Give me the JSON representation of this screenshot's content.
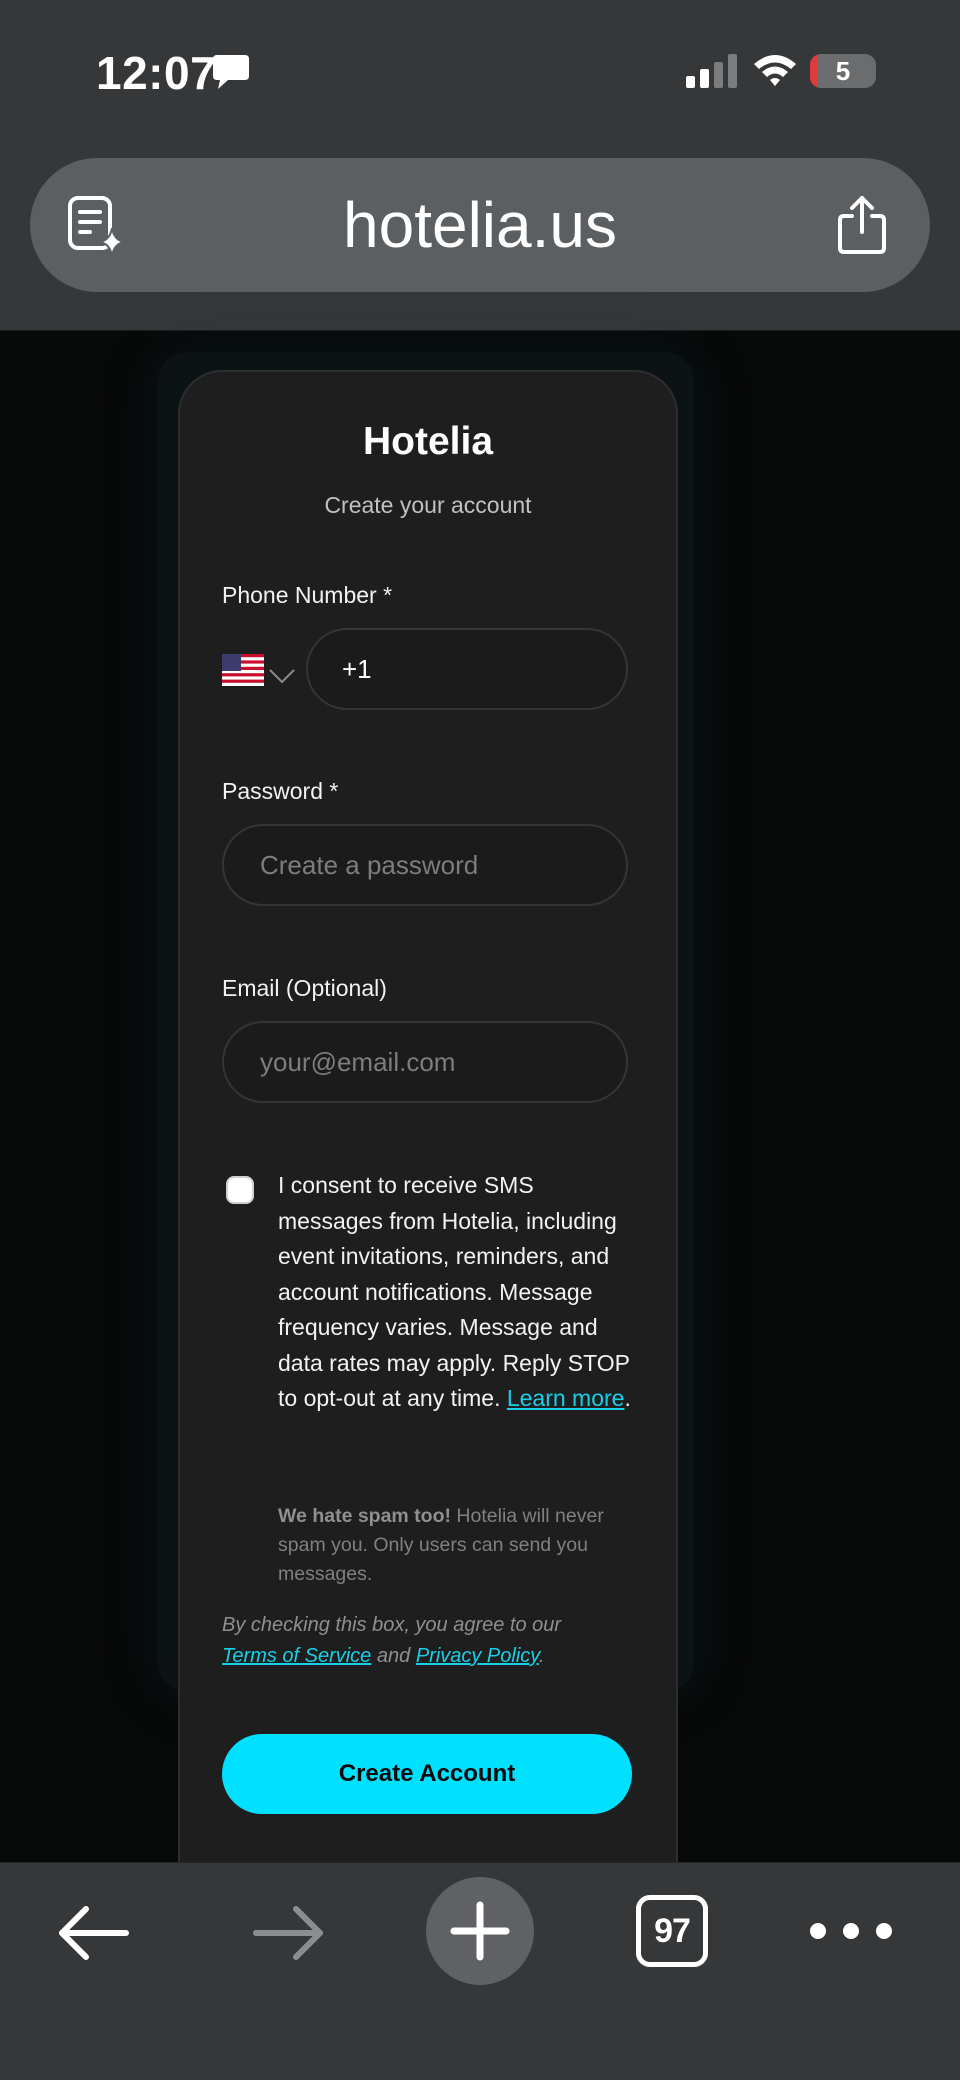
{
  "status_bar": {
    "time": "12:07",
    "battery": "5",
    "icons": [
      "message-icon",
      "signal-icon",
      "wifi-icon",
      "battery-icon"
    ]
  },
  "browser": {
    "url": "hotelia.us",
    "icons": [
      "reader-summary-icon",
      "share-icon"
    ]
  },
  "form": {
    "brand": "Hotelia",
    "subtitle": "Create your account",
    "phone_label": "Phone Number *",
    "phone_value": "+1",
    "country_flag": "us-flag-icon",
    "password_label": "Password *",
    "password_placeholder": "Create a password",
    "email_label": "Email (Optional)",
    "email_placeholder": "your@email.com",
    "consent_text": "I consent to receive SMS messages from Hotelia, including event invitations, reminders, and account notifications. Message frequency varies. Message and data rates may apply. Reply STOP to opt-out at any time.",
    "learn_more": "Learn more",
    "learn_more_suffix": ".",
    "spam_bold": "We hate spam too!",
    "spam_text": " Hotelia will never spam you. Only users can send you messages.",
    "agree_prefix": "By checking this box, you agree to our",
    "terms_link": "Terms of Service",
    "agree_and": "and",
    "privacy_link": "Privacy Policy",
    "agree_suffix": ".",
    "submit_label": "Create Account"
  },
  "bottom_bar": {
    "tab_count": "97",
    "icons": [
      "back-arrow-icon",
      "forward-arrow-icon",
      "plus-icon",
      "tabs-icon",
      "more-icon"
    ]
  },
  "colors": {
    "accent": "#00e1ff",
    "link": "#19cfe6",
    "card_bg": "#1e1e1f",
    "chrome_bg": "#353739"
  }
}
